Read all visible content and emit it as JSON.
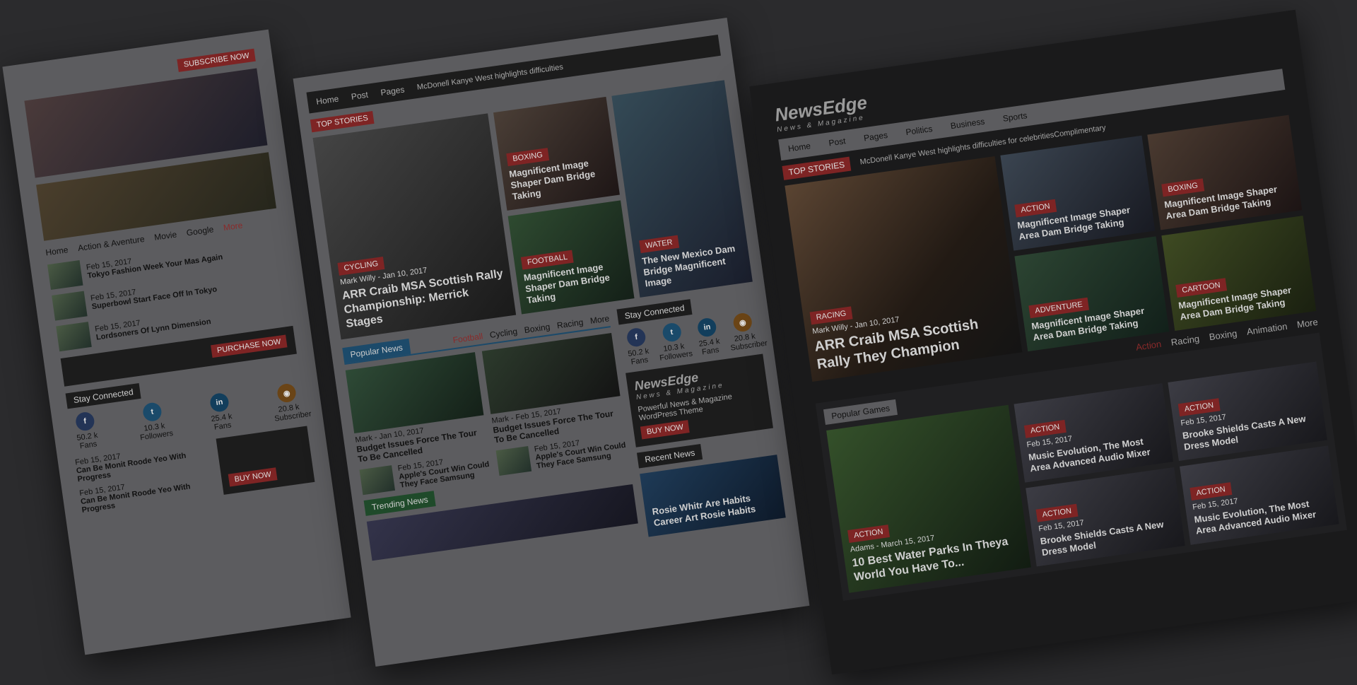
{
  "left_panel": {
    "subscribe_label": "Subscribe Now",
    "tabs": [
      "Home",
      "Action & Aventure",
      "Movie",
      "Google",
      "More"
    ],
    "list": [
      {
        "date": "Feb 15, 2017",
        "title": "Tokyo Fashion Week Your Mas Again"
      },
      {
        "date": "Feb 15, 2017",
        "title": "Superbowl Start Face Off In Tokyo"
      },
      {
        "date": "Feb 15, 2017",
        "title": "Lordsoners Of Lynn Dimension"
      }
    ],
    "purchase_label": "Purchase Now",
    "stay_connected": "Stay Connected",
    "social": [
      {
        "icon": "facebook-icon",
        "count": "50.2 k",
        "label": "Fans",
        "color": "#3b5998"
      },
      {
        "icon": "twitter-icon",
        "count": "10.3 k",
        "label": "Followers",
        "color": "#1da1f2"
      },
      {
        "icon": "linkedin-icon",
        "count": "25.4 k",
        "label": "Fans",
        "color": "#0077b5"
      },
      {
        "icon": "rss-icon",
        "count": "20.8 k",
        "label": "Subscriber",
        "color": "#f7931e"
      }
    ],
    "posts": [
      {
        "date": "Feb 15, 2017",
        "title": "Can Be Monit Roode Yeo With Progress"
      },
      {
        "date": "Feb 15, 2017",
        "title": "Can Be Monit Roode Yeo With Progress"
      }
    ],
    "buy_label": "Buy Now"
  },
  "mid_panel": {
    "nav": [
      "Home",
      "Post",
      "Pages"
    ],
    "ticker": "McDonell Kanye West highlights difficulties",
    "top_stories": "Top Stories",
    "hero": {
      "badge": "Cycling",
      "meta": "Mark Willy - Jan 10, 2017",
      "title": "ARR Craib MSA Scottish Rally Championship: Merrick Stages"
    },
    "tiles": [
      {
        "badge": "Boxing",
        "title": "Magnificent Image Shaper Dam Bridge Taking"
      },
      {
        "badge": "Football",
        "title": "Magnificent Image Shaper Dam Bridge Taking"
      },
      {
        "badge": "Water",
        "title": "The New Mexico Dam Bridge Magnificent Image"
      }
    ],
    "popular_news": "Popular News",
    "tabs": [
      "Football",
      "Cycling",
      "Boxing",
      "Racing",
      "More"
    ],
    "articles": [
      {
        "meta": "Mark - Jan 10, 2017",
        "title": "Budget Issues Force The Tour To Be Cancelled"
      },
      {
        "meta": "Mark - Feb 15, 2017",
        "title": "Budget Issues Force The Tour To Be Cancelled"
      }
    ],
    "small_list": [
      {
        "date": "Feb 15, 2017",
        "title": "Apple's Court Win Could They Face Samsung"
      },
      {
        "date": "Feb 15, 2017",
        "title": "Apple's Court Win Could They Face Samsung"
      }
    ],
    "stay_connected": "Stay Connected",
    "social": [
      {
        "icon": "facebook-icon",
        "count": "50.2 k",
        "label": "Fans",
        "color": "#3b5998"
      },
      {
        "icon": "twitter-icon",
        "count": "10.3 k",
        "label": "Followers",
        "color": "#1da1f2"
      },
      {
        "icon": "linkedin-icon",
        "count": "25.4 k",
        "label": "Fans",
        "color": "#0077b5"
      },
      {
        "icon": "rss-icon",
        "count": "20.8 k",
        "label": "Subscriber",
        "color": "#f7931e"
      }
    ],
    "ad": {
      "logo": "NewsEdge",
      "tagline": "News & Magazine",
      "text": "Powerful News & Magazine WordPress Theme",
      "button": "Buy Now"
    },
    "recent_news": "Recent News",
    "recent_title": "Rosie Whitr Are Habits Career Art Rosie Habits",
    "trending_news": "Trending News"
  },
  "right_panel": {
    "logo": "NewsEdge",
    "logo_sub": "News & Magazine",
    "nav": [
      "Home",
      "Post",
      "Pages",
      "Politics",
      "Business",
      "Sports"
    ],
    "ticker": "McDonell Kanye West highlights difficulties for celebritiesComplimentary",
    "top_stories": "Top Stories",
    "hero": {
      "badge": "Racing",
      "meta": "Mark Willy - Jan 10, 2017",
      "title": "ARR Craib MSA Scottish Rally They Champion"
    },
    "tiles": [
      {
        "badge": "Action",
        "title": "Magnificent Image Shaper Area Dam Bridge Taking"
      },
      {
        "badge": "Boxing",
        "title": "Magnificent Image Shaper Area Dam Bridge Taking"
      },
      {
        "badge": "Adventure",
        "title": "Magnificent Image Shaper Area Dam Bridge Taking"
      },
      {
        "badge": "Cartoon",
        "title": "Magnificent Image Shaper Area Dam Bridge Taking"
      }
    ],
    "tabs": [
      "Action",
      "Racing",
      "Boxing",
      "Animation",
      "More"
    ],
    "popular_games": "Popular Games",
    "games": [
      {
        "badge": "Action",
        "meta": "Adams - March 15, 2017",
        "title": "10 Best Water Parks In Theya World You Have To..."
      },
      {
        "badge": "Action",
        "date": "Feb 15, 2017",
        "title": "Music Evolution, The Most Area Advanced Audio Mixer"
      },
      {
        "badge": "Action",
        "date": "Feb 15, 2017",
        "title": "Brooke Shields Casts A New Dress Model"
      },
      {
        "badge": "Action",
        "date": "Feb 15, 2017",
        "title": "Brooke Shields Casts A New Dress Model"
      },
      {
        "badge": "Action",
        "date": "Feb 15, 2017",
        "title": "Music Evolution, The Most Area Advanced Audio Mixer"
      }
    ]
  }
}
